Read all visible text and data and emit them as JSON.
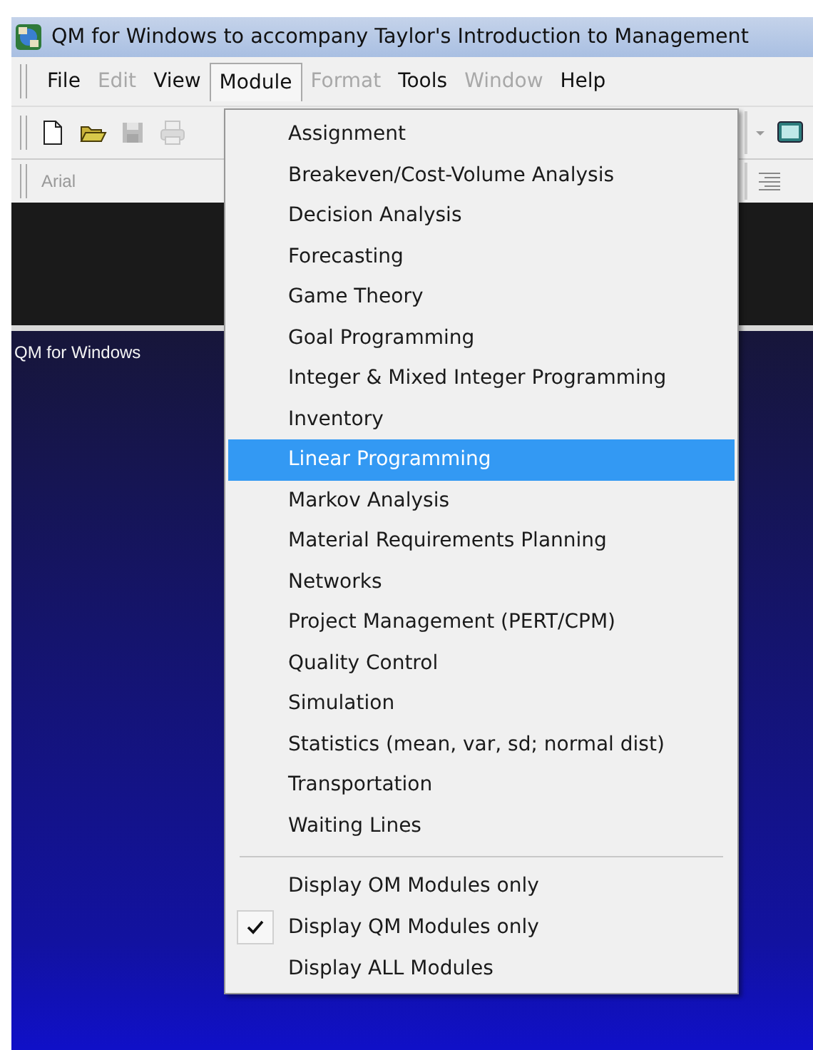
{
  "window": {
    "title": "QM for Windows to accompany Taylor's Introduction to Management"
  },
  "menu_bar": [
    {
      "label": "File",
      "disabled": false,
      "selected": false
    },
    {
      "label": "Edit",
      "disabled": true,
      "selected": false
    },
    {
      "label": "View",
      "disabled": false,
      "selected": false
    },
    {
      "label": "Module",
      "disabled": false,
      "selected": true
    },
    {
      "label": "Format",
      "disabled": true,
      "selected": false
    },
    {
      "label": "Tools",
      "disabled": false,
      "selected": false
    },
    {
      "label": "Window",
      "disabled": true,
      "selected": false
    },
    {
      "label": "Help",
      "disabled": false,
      "selected": false
    }
  ],
  "toolbar": [
    {
      "kind": "new",
      "disabled": false
    },
    {
      "kind": "open",
      "disabled": false
    },
    {
      "kind": "save",
      "disabled": true
    },
    {
      "kind": "print",
      "disabled": true
    }
  ],
  "font_field": {
    "value": "Arial"
  },
  "panel": {
    "title": "QM for Windows"
  },
  "module_menu": {
    "modules": [
      {
        "label": "Assignment",
        "selected": false
      },
      {
        "label": "Breakeven/Cost-Volume Analysis",
        "selected": false
      },
      {
        "label": "Decision Analysis",
        "selected": false
      },
      {
        "label": "Forecasting",
        "selected": false
      },
      {
        "label": "Game Theory",
        "selected": false
      },
      {
        "label": "Goal Programming",
        "selected": false
      },
      {
        "label": "Integer & Mixed Integer Programming",
        "selected": false
      },
      {
        "label": "Inventory",
        "selected": false
      },
      {
        "label": "Linear Programming",
        "selected": true
      },
      {
        "label": "Markov Analysis",
        "selected": false
      },
      {
        "label": "Material Requirements Planning",
        "selected": false
      },
      {
        "label": "Networks",
        "selected": false
      },
      {
        "label": "Project Management (PERT/CPM)",
        "selected": false
      },
      {
        "label": "Quality Control",
        "selected": false
      },
      {
        "label": "Simulation",
        "selected": false
      },
      {
        "label": "Statistics (mean, var, sd; normal dist)",
        "selected": false
      },
      {
        "label": "Transportation",
        "selected": false
      },
      {
        "label": "Waiting Lines",
        "selected": false
      }
    ],
    "display_options": [
      {
        "label": "Display OM Modules only",
        "checked": false
      },
      {
        "label": "Display QM Modules only",
        "checked": true
      },
      {
        "label": "Display ALL Modules",
        "checked": false
      }
    ]
  }
}
